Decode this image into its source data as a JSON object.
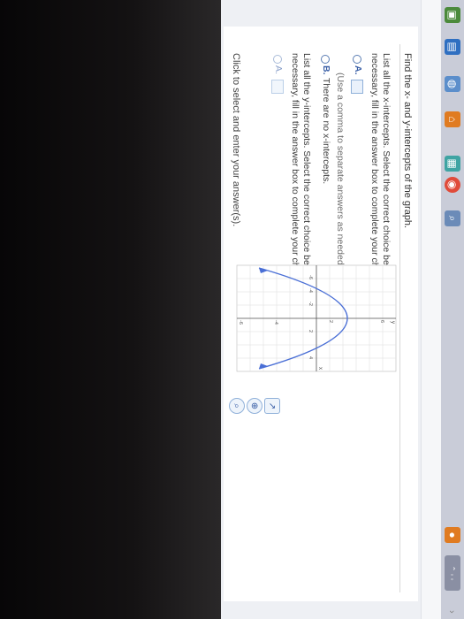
{
  "question": {
    "title": "Find the x- and y-intercepts of the graph.",
    "x_part": {
      "instruction_line1": "List all the x-intercepts. Select the correct choice below and, if",
      "instruction_line2": "necessary, fill in the answer box to complete your choice.",
      "choice_a_label": "A.",
      "choice_a_hint": "(Use a comma to separate answers as needed.)",
      "choice_b_label": "B.",
      "choice_b_text": "There are no x-intercepts."
    },
    "y_part": {
      "instruction_line1": "List all the y-intercepts. Select the correct choice below and, if",
      "instruction_line2": "necessary, fill in the answer box to complete your choice.",
      "choice_a_label": "A."
    },
    "footer": "Click to select and enter your answer(s)."
  },
  "graph": {
    "axis_labels": {
      "x": "x",
      "y": "y"
    },
    "tick_labels": [
      "6",
      "2",
      "-6",
      "-4",
      "-2",
      "2",
      "4",
      "-4",
      "-6"
    ]
  },
  "colors": {
    "accent": "#3a5fa6",
    "curve": "#4a6fd6",
    "taskbar": "#c9ccd8"
  },
  "icons": [
    "search-icon",
    "zoom-icon",
    "external-link-icon",
    "windows-icon",
    "chrome-icon",
    "home-icon"
  ]
}
